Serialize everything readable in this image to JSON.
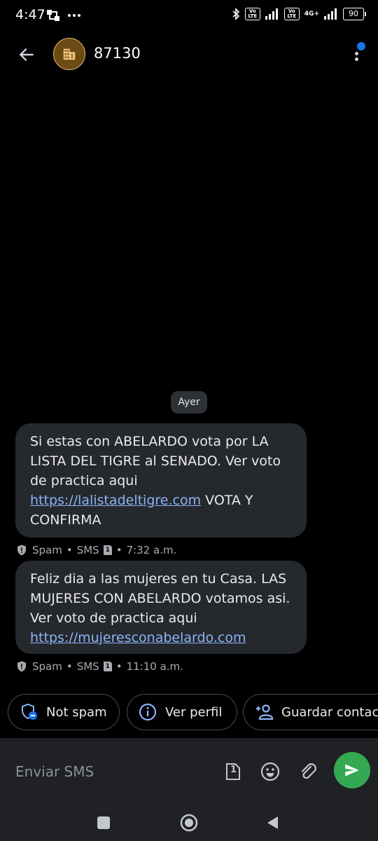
{
  "status_bar": {
    "time": "4:47",
    "battery": "90",
    "volte1": "Vo LTE",
    "volte2": "Vo LTE",
    "network": "4G+"
  },
  "header": {
    "contact_name": "87130"
  },
  "conversation": {
    "date_separator": "Ayer",
    "messages": [
      {
        "text_before_link": "Si estas con ABELARDO vota por LA LISTA DEL TIGRE al SENADO. Ver voto de practica aqui ",
        "link": "https://lalistadeltigre.com",
        "text_after_link": " VOTA Y CONFIRMA",
        "label": "Spam",
        "channel": "SMS",
        "sim": "1",
        "time": "7:32 a.m."
      },
      {
        "text_before_link": "Feliz dia a las mujeres en tu Casa. LAS MUJERES CON ABELARDO votamos asi. Ver voto de practica aqui ",
        "link": "https://mujeresconabelardo.com",
        "text_after_link": "",
        "label": "Spam",
        "channel": "SMS",
        "sim": "1",
        "time": "11:10 a.m."
      }
    ]
  },
  "actions": {
    "not_spam": "Not spam",
    "view_profile": "Ver perfil",
    "save_contact": "Guardar contacto"
  },
  "compose": {
    "placeholder": "Enviar SMS",
    "sim": "1"
  },
  "colors": {
    "background": "#000000",
    "bubble": "#25282c",
    "link": "#8ab4f8",
    "send": "#34a853",
    "avatar": "#6b4a14",
    "notification": "#1a73e8"
  }
}
